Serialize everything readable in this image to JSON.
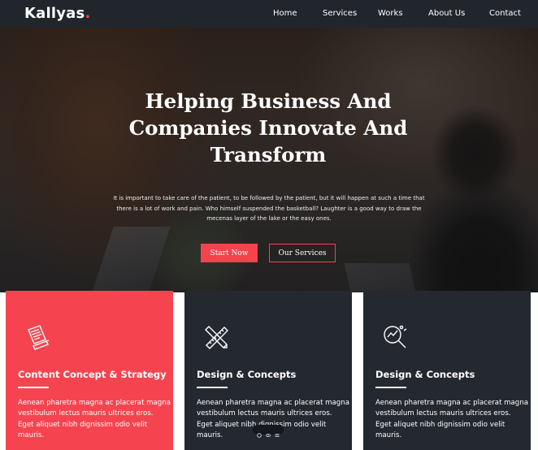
{
  "brand": {
    "name": "Kallyas",
    "dot": ".",
    "accent": "#f5424d"
  },
  "nav": {
    "items": [
      {
        "label": "Home"
      },
      {
        "label": "Services"
      },
      {
        "label": "Works"
      },
      {
        "label": "About Us"
      },
      {
        "label": "Contact"
      }
    ]
  },
  "hero": {
    "title": "Helping Business And Companies Innovate And Transform",
    "text": "It is important to take care of the patient, to be followed by the patient, but it will happen at such a time that there is a lot of work and pain. Who himself suspended the basketball? Laughter is a good way to draw the mecenas layer of the lake or the easy ones.",
    "primary_button": "Start Now",
    "secondary_button": "Our Services"
  },
  "cards": [
    {
      "title": "Content Concept & Strategy",
      "text": "Aenean pharetra magna ac placerat magna vestibulum lectus mauris ultrices eros. Eget aliquet nibh dignissim odio velit mauris.",
      "icon": "document-pencil-icon",
      "color": "#f5444f"
    },
    {
      "title": "Design & Concepts",
      "text": "Aenean pharetra magna ac placerat magna vestibulum lectus mauris ultrices eros. Eget aliquet nibh dignissim odio velit mauris.",
      "icon": "pencil-ruler-icon",
      "color": "#242930"
    },
    {
      "title": "Design & Concepts",
      "text": "Aenean pharetra magna ac placerat magna vestibulum lectus mauris ultrices eros. Eget aliquet nibh dignissim odio velit mauris.",
      "icon": "magnifier-analytics-icon",
      "color": "#242930"
    }
  ],
  "colors": {
    "nav_bg": "#21262d",
    "card_dark": "#242930",
    "card_red": "#f5444f"
  }
}
